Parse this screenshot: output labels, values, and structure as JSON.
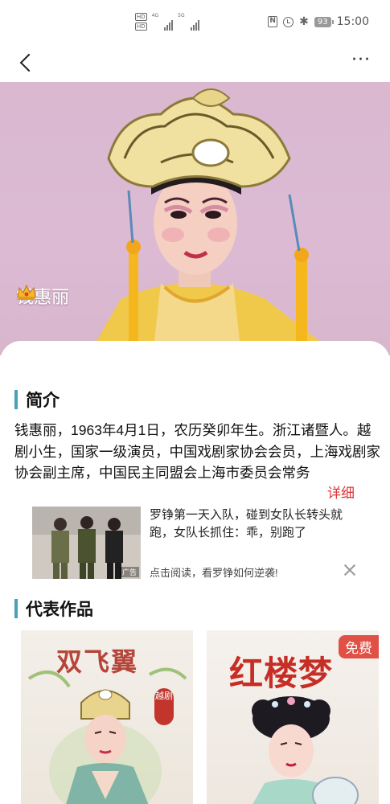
{
  "status_bar": {
    "hd1": "HD",
    "hd2": "HD",
    "net1": "4G",
    "net2": "5G",
    "battery": "93",
    "time": "15:00"
  },
  "nav": {
    "back_icon": "chevron-left-icon",
    "more_label": "···"
  },
  "hero": {
    "name": "钱惠丽",
    "crown_icon": "crown-icon"
  },
  "intro": {
    "title": "简介",
    "text": "钱惠丽，1963年4月1日，农历癸卯年生。浙江诸暨人。越剧小生，国家一级演员，中国戏剧家协会会员，上海戏剧家协会副主席，中国民主同盟会上海市委员会常务",
    "detail_link": "详细"
  },
  "ad": {
    "title": "罗铮第一天入队，碰到女队长转头就跑，女队长抓住：乖，别跑了",
    "subtitle": "点击阅读，看罗铮如何逆袭!",
    "label": "广告"
  },
  "works": {
    "title": "代表作品",
    "items": [
      {
        "title": "双飞翼",
        "badge": "越剧"
      },
      {
        "title": "红楼梦",
        "badge": "免费"
      }
    ]
  },
  "colors": {
    "accent_bar": "#4aa0b7",
    "detail_link": "#dd3333",
    "free_badge": "#e05045"
  }
}
